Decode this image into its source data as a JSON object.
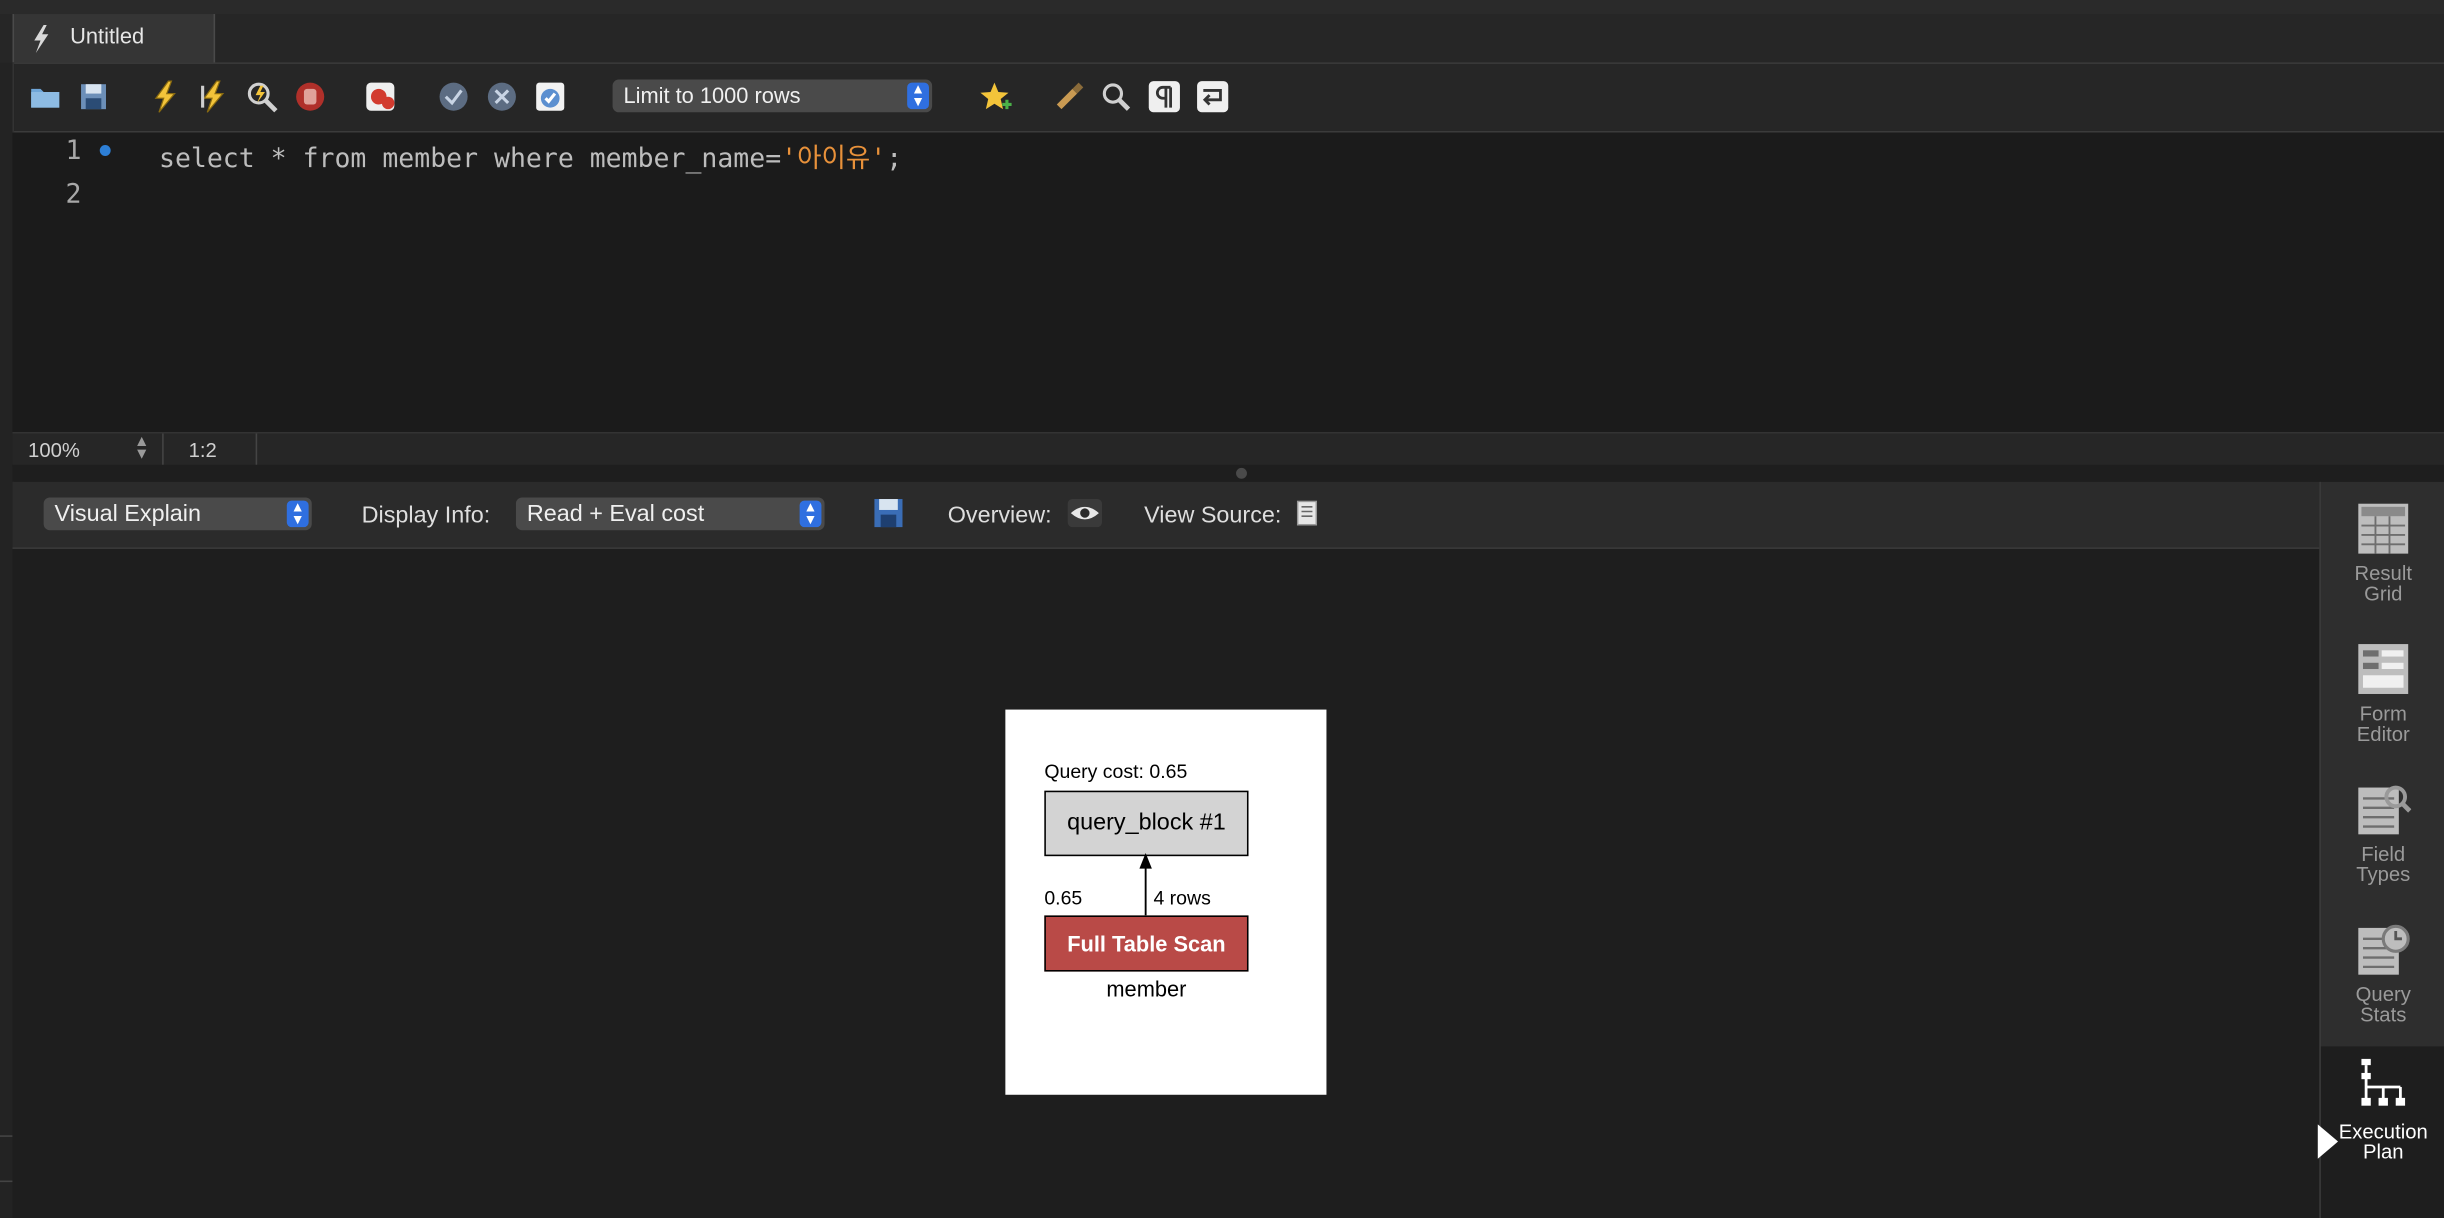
{
  "tab": {
    "title": "Untitled"
  },
  "toolbar": {
    "limit_value": "Limit to 1000 rows",
    "icons": [
      "open-folder-icon",
      "save-icon",
      "execute-icon",
      "execute-current-icon",
      "explain-icon",
      "stop-icon",
      "toggle-error-icon",
      "commit-icon",
      "rollback-icon",
      "autocommit-icon",
      "beautify-icon",
      "clean-icon",
      "find-icon",
      "invisibles-icon",
      "wrap-icon"
    ]
  },
  "editor": {
    "line_numbers": [
      "1",
      "2"
    ],
    "code": {
      "prefix": "select * from member where member_name=",
      "string": "'아이유'",
      "suffix": ";"
    }
  },
  "status": {
    "zoom": "100%",
    "cursor_position": "1:2"
  },
  "result_toolbar": {
    "view_mode": "Visual Explain",
    "display_info_label": "Display Info:",
    "display_info_value": "Read + Eval cost",
    "overview_label": "Overview:",
    "view_source_label": "View Source:"
  },
  "explain_diagram": {
    "query_cost": "Query cost: 0.65",
    "query_block": "query_block #1",
    "cost": "0.65",
    "rows": "4 rows",
    "access_type": "Full Table Scan",
    "table": "member",
    "access_color": "#b94a47"
  },
  "side_panel": {
    "items": [
      {
        "label1": "Result",
        "label2": "Grid"
      },
      {
        "label1": "Form",
        "label2": "Editor"
      },
      {
        "label1": "Field",
        "label2": "Types"
      },
      {
        "label1": "Query",
        "label2": "Stats"
      },
      {
        "label1": "Execution",
        "label2": "Plan"
      }
    ],
    "active": "Execution Plan"
  }
}
